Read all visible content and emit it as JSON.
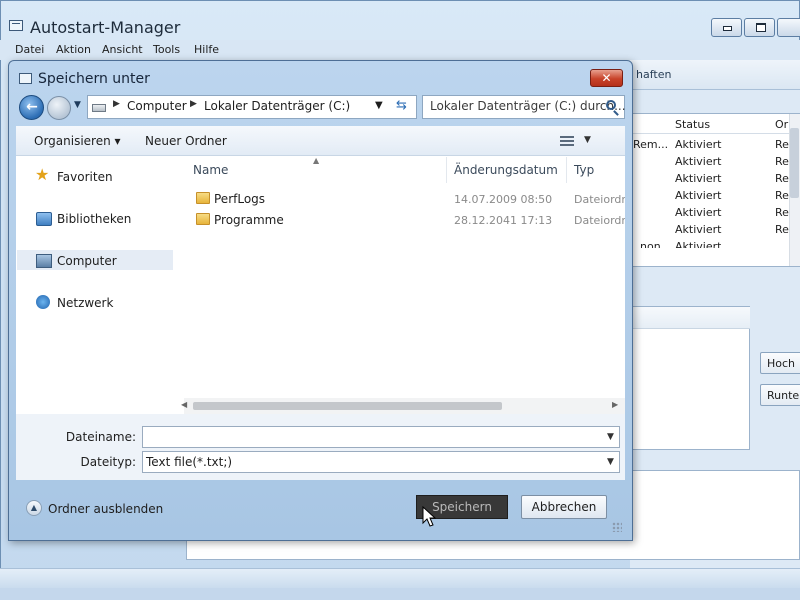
{
  "app": {
    "title": "Autostart-Manager",
    "menu": [
      "Datei",
      "Aktion",
      "Ansicht",
      "Tools",
      "Hilfe"
    ]
  },
  "background": {
    "tab_label": "haften",
    "columns": [
      "Status",
      "Or"
    ],
    "row_partial_text": "Rem...",
    "row_partial_text2": "non",
    "rows": [
      {
        "status": "Aktiviert",
        "or": "Re"
      },
      {
        "status": "Aktiviert",
        "or": "Re"
      },
      {
        "status": "Aktiviert",
        "or": "Re"
      },
      {
        "status": "Aktiviert",
        "or": "Re"
      },
      {
        "status": "Aktiviert",
        "or": "Re"
      },
      {
        "status": "Aktiviert",
        "or": "Re"
      },
      {
        "status": "Aktiviert",
        "or": "Re"
      }
    ],
    "buttons": {
      "up": "Hoch",
      "down": "Runter"
    }
  },
  "dialog": {
    "title": "Speichern unter",
    "close_glyph": "✕",
    "breadcrumb": [
      "Computer",
      "Lokaler Datenträger (C:)"
    ],
    "search_placeholder": "Lokaler Datenträger (C:) durch...",
    "toolbar": {
      "organize": "Organisieren ▾",
      "new_folder": "Neuer Ordner"
    },
    "nav": [
      {
        "label": "Favoriten",
        "icon": "star-icon"
      },
      {
        "label": "Bibliotheken",
        "icon": "library-icon"
      },
      {
        "label": "Computer",
        "icon": "computer-icon",
        "selected": true
      },
      {
        "label": "Netzwerk",
        "icon": "network-icon"
      }
    ],
    "columns": {
      "name": "Name",
      "date": "Änderungsdatum",
      "type": "Typ"
    },
    "files": [
      {
        "name": "PerfLogs",
        "date": "14.07.2009 08:50",
        "type": "Dateiordner"
      },
      {
        "name": "Programme",
        "date": "28.12.2041 17:13",
        "type": "Dateiordner"
      }
    ],
    "filename_label": "Dateiname:",
    "filename_value": "",
    "filetype_label": "Dateityp:",
    "filetype_value": "Text file(*.txt;)",
    "hide_folders": "Ordner ausblenden",
    "save": "Speichern",
    "cancel": "Abbrechen"
  }
}
